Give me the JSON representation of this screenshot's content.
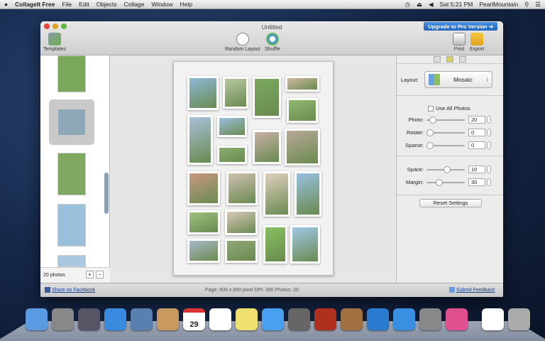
{
  "menubar": {
    "apple": "",
    "app": "CollageIt Free",
    "items": [
      "File",
      "Edit",
      "Objects",
      "Collage",
      "Window",
      "Help"
    ],
    "clock": "Sat 5:21 PM",
    "user": "PearlMountain"
  },
  "window": {
    "title": "Untitled",
    "upgrade": "Upgrade to Pro Version"
  },
  "toolbar": {
    "templates": "Templates",
    "random_layout": "Random Layout",
    "shuffle": "Shuffle",
    "print": "Print",
    "export": "Export"
  },
  "sidebar": {
    "count": "20 photos",
    "add": "+",
    "remove": "−"
  },
  "settings": {
    "layout_label": "Layout:",
    "layout_value": "Mosaic",
    "use_all": "Use All Photos",
    "use_all_checked": false,
    "sliders": [
      {
        "label": "Photo:",
        "value": "20",
        "level": 0.1
      },
      {
        "label": "Rotate:",
        "value": "0",
        "level": 0
      },
      {
        "label": "Sparse:",
        "value": "0",
        "level": 0
      }
    ],
    "sliders2": [
      {
        "label": "Space:",
        "value": "10",
        "level": 0.55
      },
      {
        "label": "Margin:",
        "value": "30",
        "level": 0.3
      }
    ],
    "reset": "Reset Settings"
  },
  "status": {
    "facebook": "Share on Facebook",
    "info": "Page: 600 x 800 pixel DPI: 300 Photos: 20",
    "feedback": "Submit Feedback"
  },
  "dock": [
    "finder",
    "launchpad",
    "mission-control",
    "safari",
    "mail",
    "contacts",
    "calendar",
    "reminders",
    "notes",
    "messages",
    "facetime",
    "photo-booth",
    "iphoto",
    "itunes",
    "app-store",
    "system-preferences",
    "collageit",
    "documents",
    "trash"
  ],
  "dock_calendar_day": "29",
  "colors": {
    "accent": "#1e63c0"
  }
}
